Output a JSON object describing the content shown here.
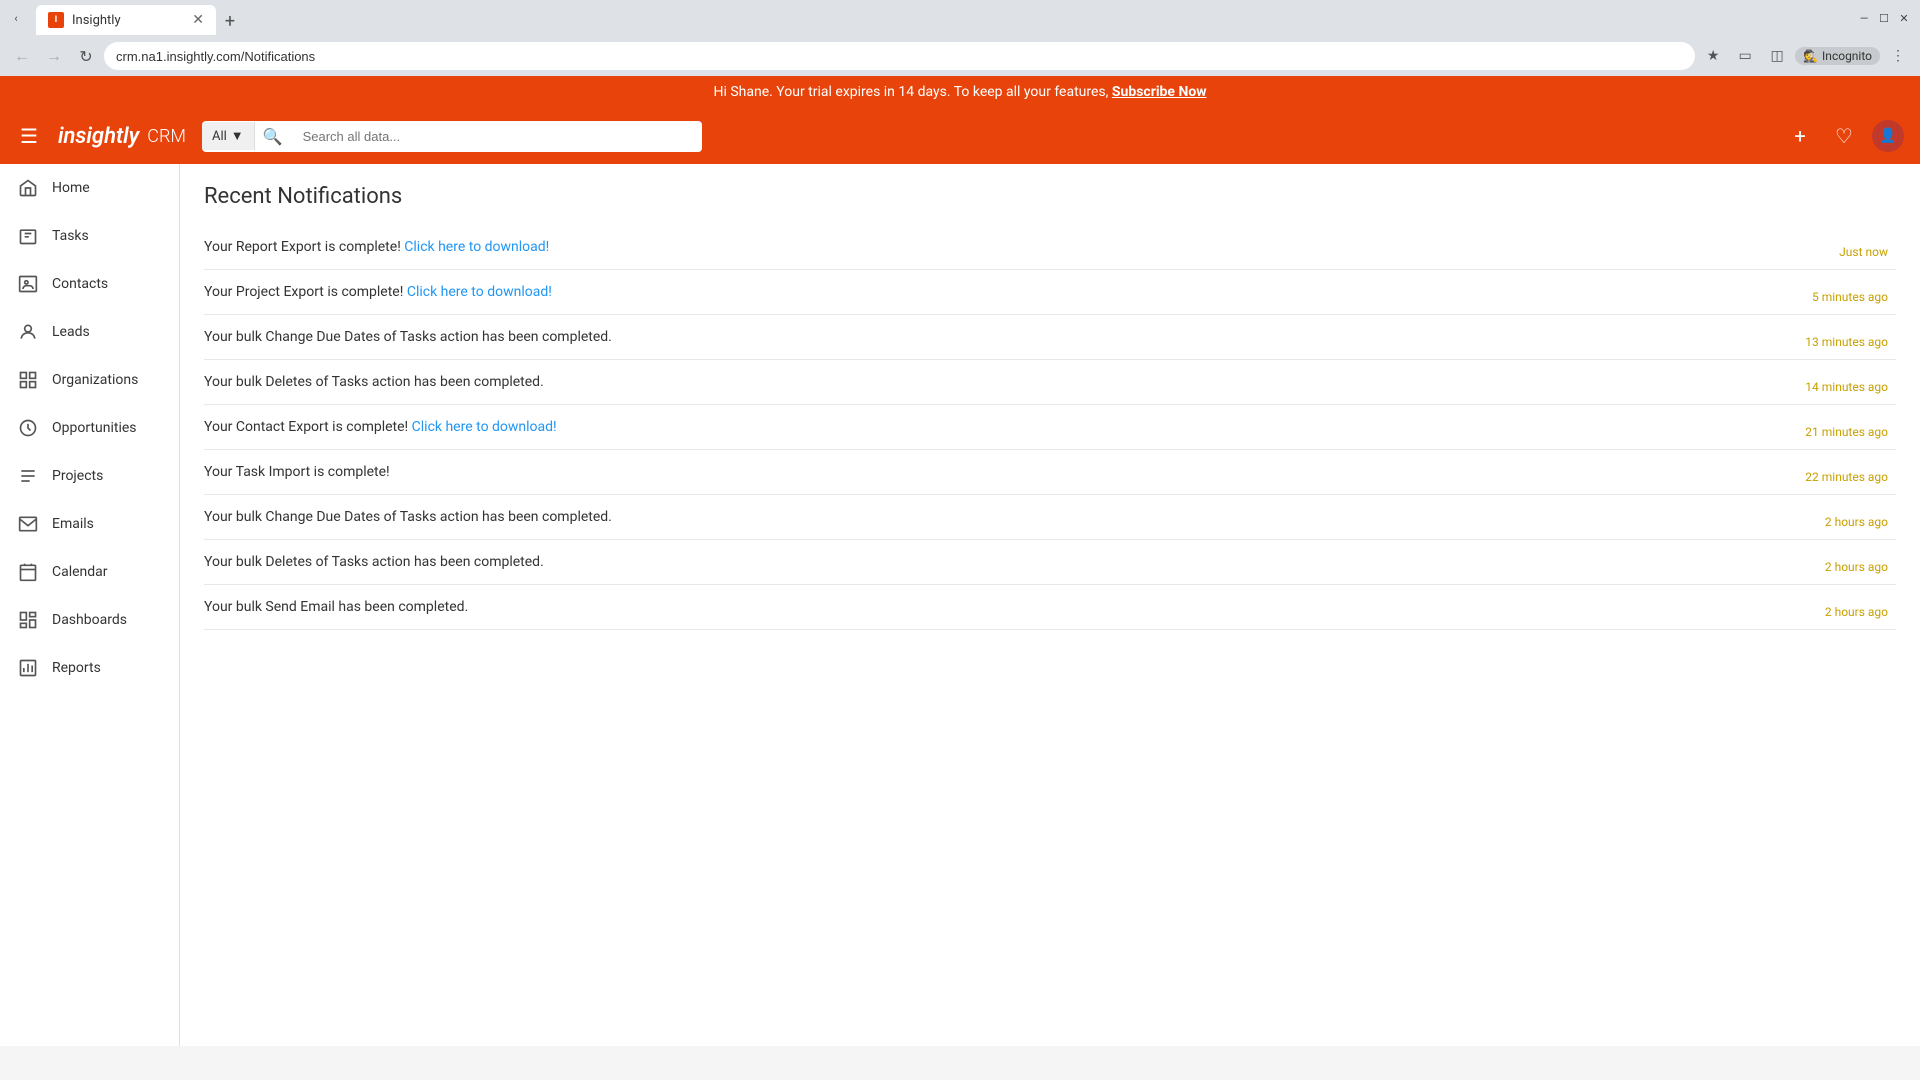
{
  "browser": {
    "tab_title": "Insightly",
    "tab_favicon": "I",
    "address": "crm.na1.insightly.com/Notifications",
    "incognito_label": "Incognito"
  },
  "trial_banner": {
    "text_before": "Hi Shane. Your trial expires in 14 days. To keep all your features, ",
    "link_text": "Subscribe Now"
  },
  "header": {
    "logo": "insightly",
    "crm_label": "CRM",
    "search_dropdown": "All",
    "search_placeholder": "Search all data..."
  },
  "sidebar": {
    "items": [
      {
        "id": "home",
        "label": "Home",
        "icon": "home"
      },
      {
        "id": "tasks",
        "label": "Tasks",
        "icon": "tasks"
      },
      {
        "id": "contacts",
        "label": "Contacts",
        "icon": "contacts"
      },
      {
        "id": "leads",
        "label": "Leads",
        "icon": "leads"
      },
      {
        "id": "organizations",
        "label": "Organizations",
        "icon": "organizations"
      },
      {
        "id": "opportunities",
        "label": "Opportunities",
        "icon": "opportunities"
      },
      {
        "id": "projects",
        "label": "Projects",
        "icon": "projects"
      },
      {
        "id": "emails",
        "label": "Emails",
        "icon": "emails"
      },
      {
        "id": "calendar",
        "label": "Calendar",
        "icon": "calendar"
      },
      {
        "id": "dashboards",
        "label": "Dashboards",
        "icon": "dashboards"
      },
      {
        "id": "reports",
        "label": "Reports",
        "icon": "reports"
      }
    ]
  },
  "page": {
    "title": "Recent Notifications"
  },
  "notifications": [
    {
      "id": 1,
      "text_before": "Your Report Export is complete! ",
      "link_text": "Click here to download!",
      "text_after": "",
      "time": "Just now"
    },
    {
      "id": 2,
      "text_before": "Your Project Export is complete! ",
      "link_text": "Click here to download!",
      "text_after": "",
      "time": "5 minutes ago"
    },
    {
      "id": 3,
      "text_before": "Your bulk Change Due Dates of Tasks action has been completed.",
      "link_text": "",
      "text_after": "",
      "time": "13 minutes ago"
    },
    {
      "id": 4,
      "text_before": "Your bulk Deletes of Tasks action has been completed.",
      "link_text": "",
      "text_after": "",
      "time": "14 minutes ago"
    },
    {
      "id": 5,
      "text_before": "Your Contact Export is complete! ",
      "link_text": "Click here to download!",
      "text_after": "",
      "time": "21 minutes ago"
    },
    {
      "id": 6,
      "text_before": "Your Task Import is complete!",
      "link_text": "",
      "text_after": "",
      "time": "22 minutes ago"
    },
    {
      "id": 7,
      "text_before": "Your bulk Change Due Dates of Tasks action has been completed.",
      "link_text": "",
      "text_after": "",
      "time": "2 hours ago"
    },
    {
      "id": 8,
      "text_before": "Your bulk Deletes of Tasks action has been completed.",
      "link_text": "",
      "text_after": "",
      "time": "2 hours ago"
    },
    {
      "id": 9,
      "text_before": "Your bulk Send Email has been completed.",
      "link_text": "",
      "text_after": "",
      "time": "2 hours ago"
    }
  ]
}
